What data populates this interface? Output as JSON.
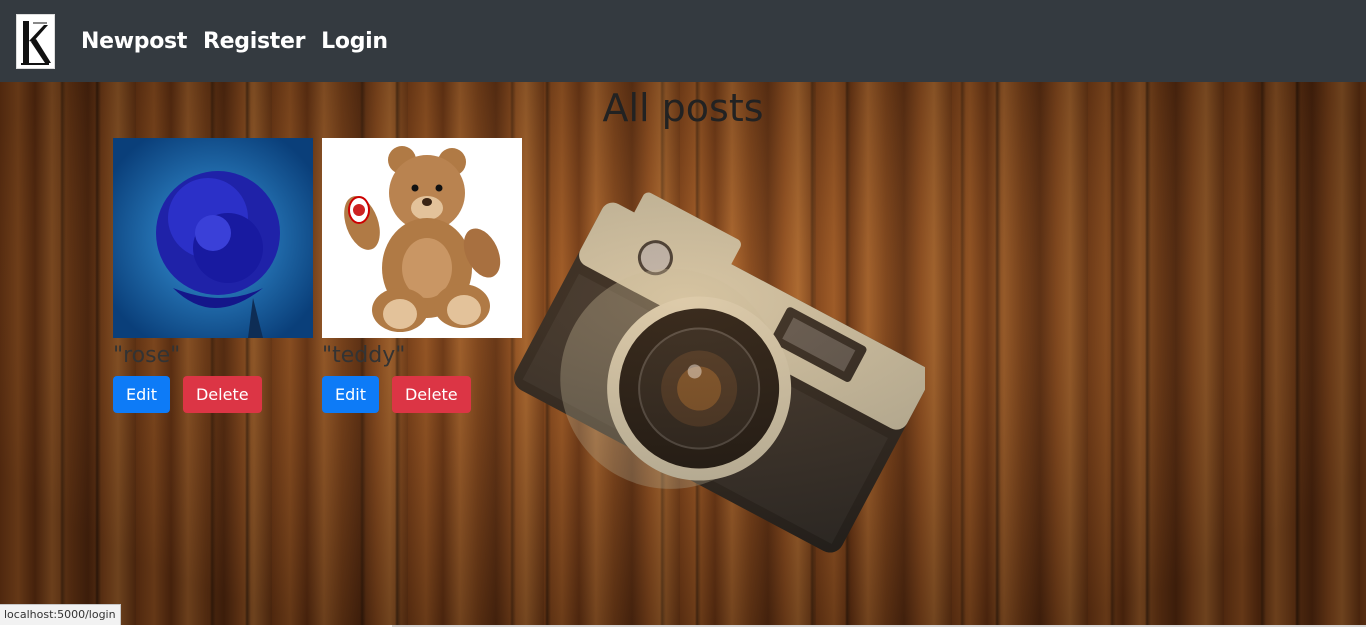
{
  "nav": {
    "items": [
      "Newpost",
      "Register",
      "Login"
    ]
  },
  "main": {
    "title": "All posts",
    "posts": [
      {
        "name": "\"rose\"",
        "image": "blue-rose-photo",
        "edit_label": "Edit",
        "delete_label": "Delete"
      },
      {
        "name": "\"teddy\"",
        "image": "teddy-bear-photo",
        "edit_label": "Edit",
        "delete_label": "Delete"
      }
    ]
  },
  "status_bar": {
    "url": "localhost:5000/login"
  },
  "colors": {
    "navbar": "#343a40",
    "edit_button": "#0d7bf7",
    "delete_button": "#dc3545"
  }
}
